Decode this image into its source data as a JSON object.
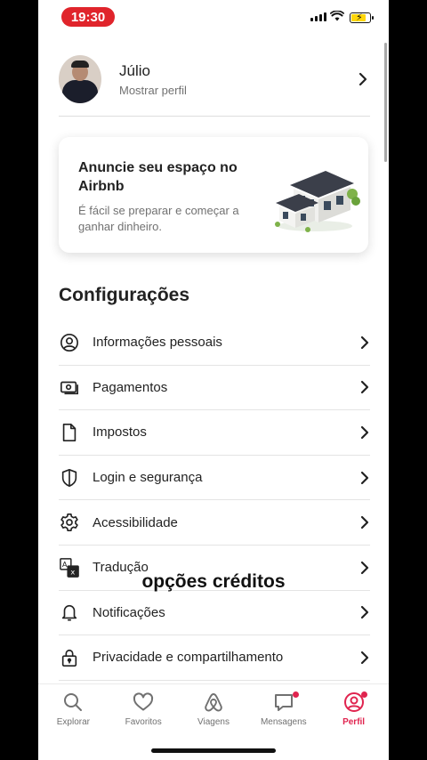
{
  "status_bar": {
    "time": "19:30",
    "time_pill_color": "#e0242b",
    "battery_color": "#ffd60a"
  },
  "profile": {
    "name": "Júlio",
    "subtitle": "Mostrar perfil",
    "avatar_icon": "user-photo"
  },
  "host_card": {
    "title": "Anuncie seu espaço no Airbnb",
    "subtitle": "É fácil se preparar e começar a ganhar dinheiro.",
    "illustration": "house-illustration"
  },
  "settings": {
    "title": "Configurações",
    "items": [
      {
        "label": "Informações pessoais",
        "icon": "user-circle-icon"
      },
      {
        "label": "Pagamentos",
        "icon": "payments-icon"
      },
      {
        "label": "Impostos",
        "icon": "document-icon"
      },
      {
        "label": "Login e segurança",
        "icon": "shield-icon"
      },
      {
        "label": "Acessibilidade",
        "icon": "gear-icon"
      },
      {
        "label": "Tradução",
        "icon": "translate-icon"
      },
      {
        "label": "Notificações",
        "icon": "bell-icon"
      },
      {
        "label": "Privacidade e compartilhamento",
        "icon": "lock-icon"
      }
    ]
  },
  "overlay_caption": "opções créditos",
  "tab_bar": {
    "accent_color": "#e0244f",
    "tabs": [
      {
        "label": "Explorar",
        "icon": "search-icon",
        "active": false,
        "badge": false
      },
      {
        "label": "Favoritos",
        "icon": "heart-icon",
        "active": false,
        "badge": false
      },
      {
        "label": "Viagens",
        "icon": "airbnb-logo-icon",
        "active": false,
        "badge": false
      },
      {
        "label": "Mensagens",
        "icon": "message-icon",
        "active": false,
        "badge": true
      },
      {
        "label": "Perfil",
        "icon": "profile-icon",
        "active": true,
        "badge": true
      }
    ]
  }
}
